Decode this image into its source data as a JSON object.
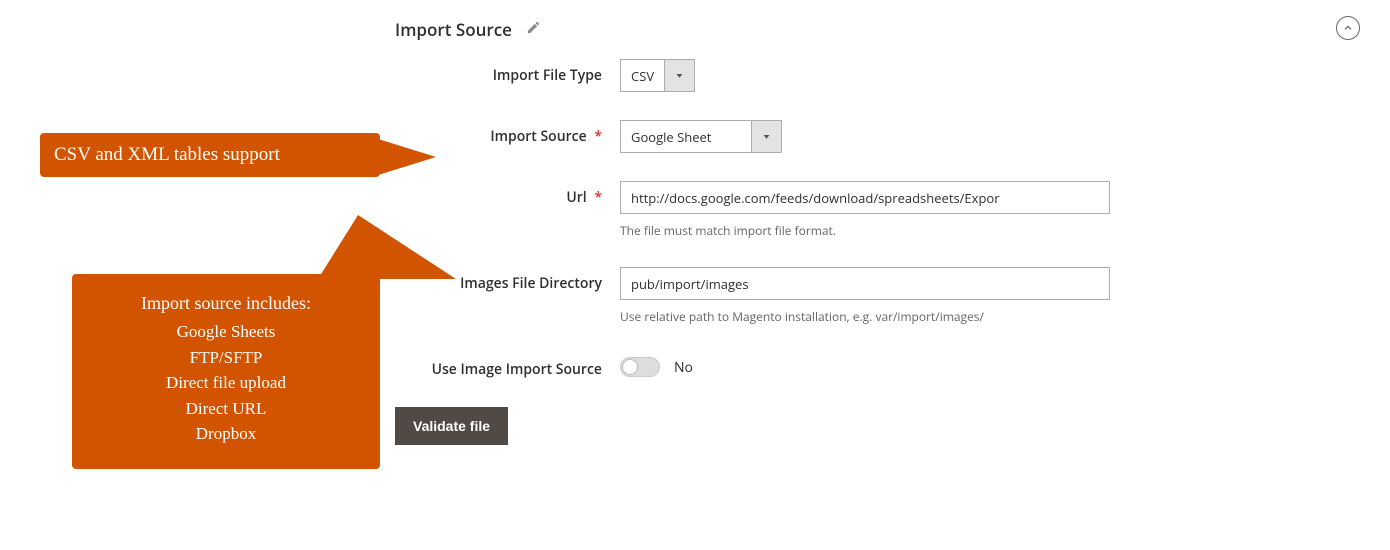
{
  "section": {
    "title": "Import Source"
  },
  "fields": {
    "file_type": {
      "label": "Import File Type",
      "value": "CSV"
    },
    "import_source": {
      "label": "Import Source",
      "value": "Google Sheet"
    },
    "url": {
      "label": "Url",
      "value": "http://docs.google.com/feeds/download/spreadsheets/Expor",
      "help": "The file must match import file format."
    },
    "images_dir": {
      "label": "Images File Directory",
      "value": "pub/import/images",
      "help": "Use relative path to Magento installation, e.g. var/import/images/"
    },
    "use_image_import_source": {
      "label": "Use Image Import Source",
      "value": "No"
    }
  },
  "buttons": {
    "validate": "Validate file"
  },
  "callouts": {
    "c1": "CSV and XML tables support",
    "c2_title": "Import source includes:",
    "c2_items": [
      "Google Sheets",
      "FTP/SFTP",
      "Direct file upload",
      "Direct URL",
      "Dropbox"
    ]
  }
}
